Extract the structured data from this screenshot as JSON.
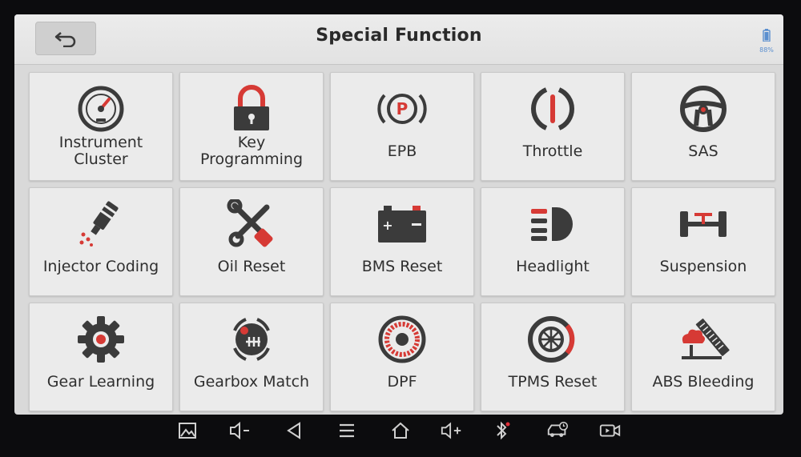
{
  "header": {
    "title": "Special Function",
    "back_icon": "back-arrow-icon",
    "battery_text": "88%",
    "battery_color": "#5b8fcf"
  },
  "tiles": [
    {
      "label": "Instrument\nCluster",
      "icon": "gauge-icon"
    },
    {
      "label": "Key\nProgramming",
      "icon": "padlock-icon"
    },
    {
      "label": "EPB",
      "icon": "parking-brake-icon"
    },
    {
      "label": "Throttle",
      "icon": "throttle-icon"
    },
    {
      "label": "SAS",
      "icon": "steering-wheel-icon"
    },
    {
      "label": "Injector Coding",
      "icon": "injector-icon"
    },
    {
      "label": "Oil Reset",
      "icon": "wrench-screwdriver-icon"
    },
    {
      "label": "BMS Reset",
      "icon": "car-battery-icon"
    },
    {
      "label": "Headlight",
      "icon": "headlight-icon"
    },
    {
      "label": "Suspension",
      "icon": "suspension-icon"
    },
    {
      "label": "Gear Learning",
      "icon": "gear-icon"
    },
    {
      "label": "Gearbox Match",
      "icon": "gear-shifter-icon"
    },
    {
      "label": "DPF",
      "icon": "dpf-filter-icon"
    },
    {
      "label": "TPMS Reset",
      "icon": "tire-pressure-icon"
    },
    {
      "label": "ABS Bleeding",
      "icon": "abs-bleeding-icon"
    }
  ],
  "nav_bar": [
    "screenshot-icon",
    "volume-down-icon",
    "back-triangle-icon",
    "menu-icon",
    "home-icon",
    "volume-up-icon",
    "bluetooth-icon",
    "vehicle-diagnostic-icon",
    "screen-record-icon"
  ],
  "colors": {
    "accent_red": "#d63a35",
    "icon_dark": "#3b3b3b"
  }
}
